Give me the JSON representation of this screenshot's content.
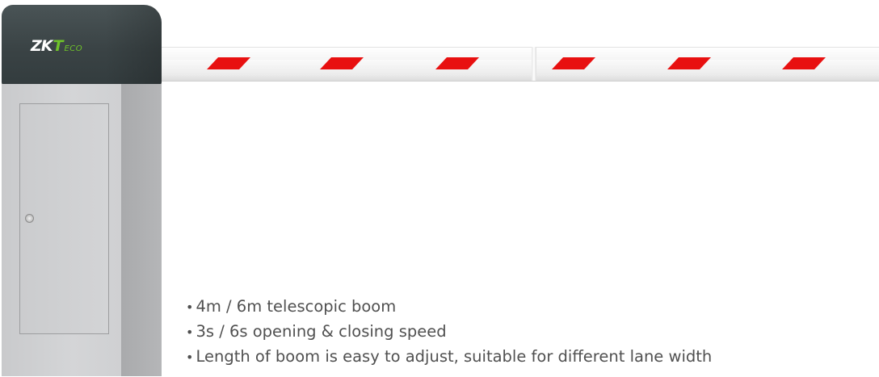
{
  "product": {
    "brand_logo_text": "ZKTeco",
    "brand_logo_parts": [
      "ZK",
      "T",
      "ECO"
    ]
  },
  "features": [
    {
      "text": "4m / 6m telescopic boom"
    },
    {
      "text": "3s / 6s opening & closing speed"
    },
    {
      "text": "Length of boom is easy to adjust, suitable for different lane width"
    }
  ],
  "colors": {
    "housing_top": "#3a4345",
    "housing_body": "#cfd0d2",
    "brand_accent": "#6fc22a",
    "boom_stripe": "#e81010",
    "text": "#505050"
  }
}
